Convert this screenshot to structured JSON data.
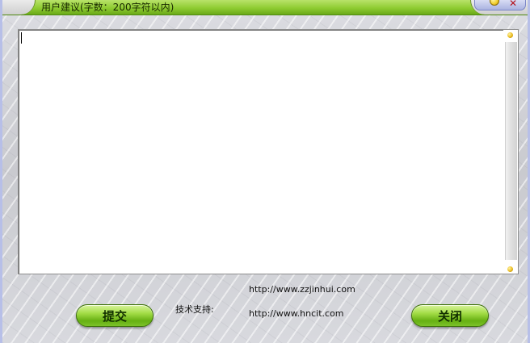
{
  "window": {
    "title": "用户建议(字数：200字符以内)"
  },
  "editor": {
    "value": "",
    "placeholder": ""
  },
  "footer": {
    "link1": "http://www.zzjinhui.com",
    "support_label": "技术支持:",
    "link2": "http://www.hncit.com"
  },
  "buttons": {
    "submit_label": "提交",
    "close_label": "关闭"
  },
  "colors": {
    "titlebar": "#8fcc32",
    "button_green": "#a2dc45",
    "window_border": "#b7bfe8"
  }
}
